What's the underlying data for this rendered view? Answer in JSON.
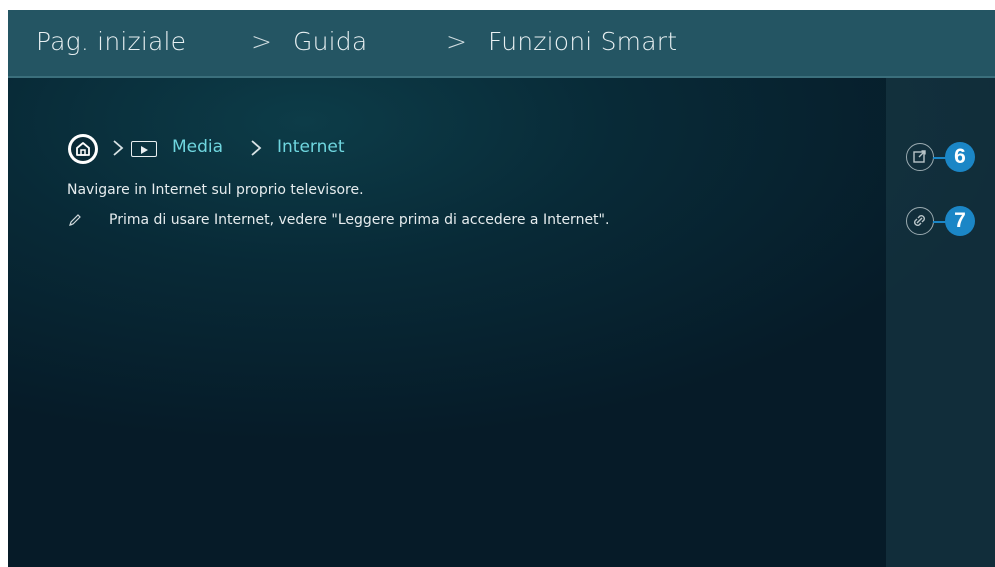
{
  "header": {
    "crumbs": [
      "Pag. iniziale",
      "Guida",
      "Funzioni Smart"
    ],
    "separator": ">"
  },
  "path": {
    "media": "Media",
    "internet": "Internet"
  },
  "content": {
    "description": "Navigare in Internet sul proprio televisore.",
    "note": "Prima di usare Internet, vedere \"Leggere prima di accedere a Internet\"."
  },
  "callouts": [
    "6",
    "7"
  ],
  "colors": {
    "header_bg": "#245563",
    "link": "#6fd6df",
    "badge": "#1b86c6"
  }
}
